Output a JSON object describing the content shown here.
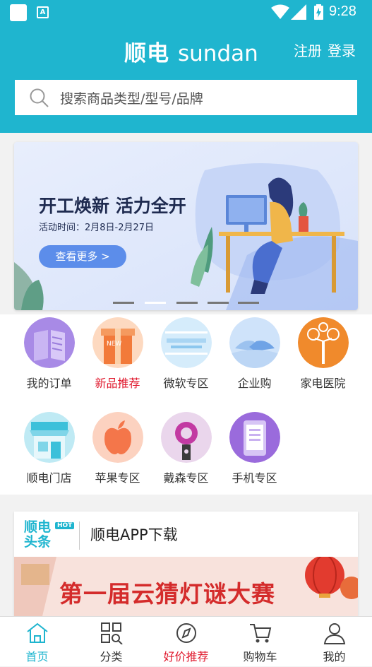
{
  "status_bar": {
    "time": "9:28",
    "notification_icon": "A"
  },
  "header": {
    "logo_cn": "顺电",
    "logo_en": "sundan",
    "register_label": "注册",
    "login_label": "登录"
  },
  "search": {
    "placeholder": "搜索商品类型/型号/品牌"
  },
  "banner": {
    "title": "开工焕新 活力全开",
    "subtitle": "活动时间：2月8日-2月27日",
    "button_label": "查看更多 >",
    "slide_count": 5,
    "active_slide": 2
  },
  "categories": [
    {
      "label": "我的订单",
      "icon": "order-book-icon",
      "highlight": false
    },
    {
      "label": "新品推荐",
      "icon": "new-gift-icon",
      "highlight": true
    },
    {
      "label": "微软专区",
      "icon": "microsoft-icon",
      "highlight": false
    },
    {
      "label": "企业购",
      "icon": "handshake-icon",
      "highlight": false
    },
    {
      "label": "家电医院",
      "icon": "appliance-tree-icon",
      "highlight": false
    },
    {
      "label": "顺电门店",
      "icon": "store-icon",
      "highlight": false
    },
    {
      "label": "苹果专区",
      "icon": "apple-icon",
      "highlight": false
    },
    {
      "label": "戴森专区",
      "icon": "dyson-icon",
      "highlight": false
    },
    {
      "label": "手机专区",
      "icon": "phone-icon",
      "highlight": false
    }
  ],
  "news": {
    "logo_line1": "顺电",
    "logo_line2": "头条",
    "hot_badge": "HOT",
    "title": "顺电APP下载",
    "banner_text": "第一届云猜灯谜大赛"
  },
  "tabbar": [
    {
      "label": "首页",
      "icon": "home-icon",
      "state": "active"
    },
    {
      "label": "分类",
      "icon": "category-grid-icon",
      "state": "normal"
    },
    {
      "label": "好价推荐",
      "icon": "compass-icon",
      "state": "hot"
    },
    {
      "label": "购物车",
      "icon": "cart-icon",
      "state": "normal"
    },
    {
      "label": "我的",
      "icon": "user-icon",
      "state": "normal"
    }
  ],
  "colors": {
    "primary": "#1fb5cf",
    "hot": "#e01a2e",
    "button": "#5c8dea"
  }
}
